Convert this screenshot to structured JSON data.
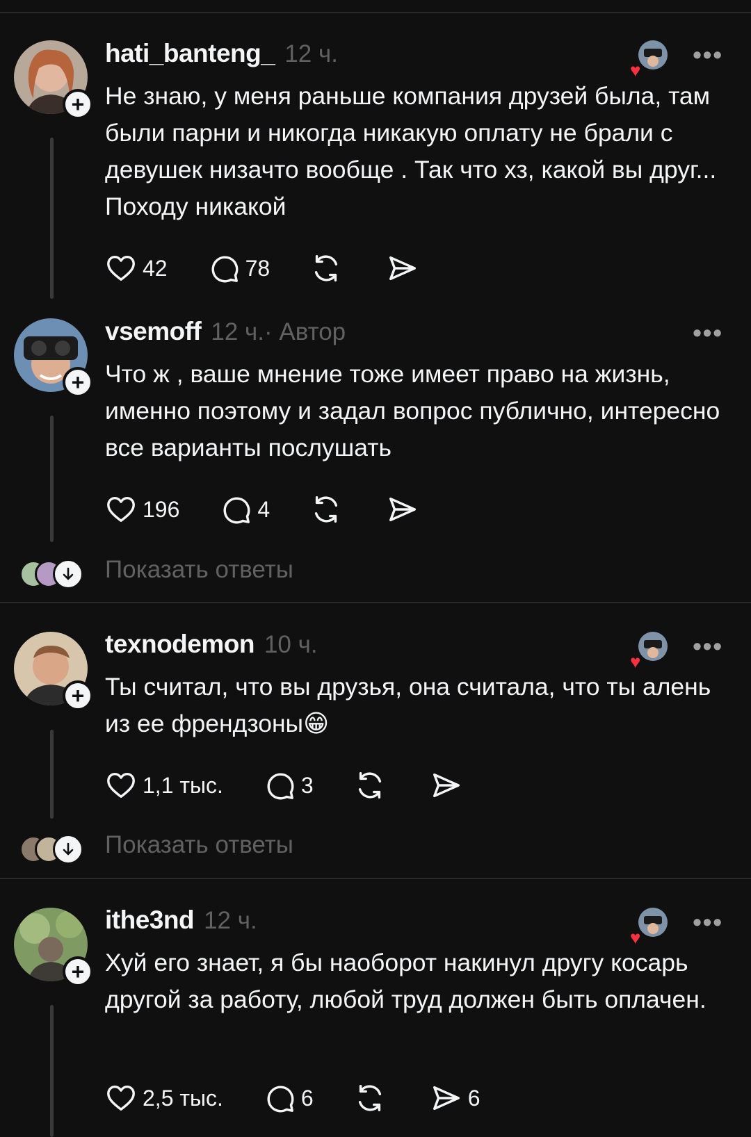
{
  "comments": [
    {
      "username": "hati_banteng_",
      "time": "12 ч.",
      "text": "Не знаю, у меня раньше компания друзей была, там были парни и никогда никакую оплату не брали с девушек низачто вообще . Так что хз, какой вы друг... Походу никакой",
      "likes": "42",
      "replies": "78",
      "avatar_color": "#c98d73"
    },
    {
      "username": "vsemoff",
      "time": "12 ч.",
      "author_label": " · Автор",
      "text": "Что ж , ваше мнение тоже имеет право на жизнь, именно поэтому и задал вопрос публично, интересно все варианты послушать",
      "likes": "196",
      "replies": "4",
      "show_replies": "Показать ответы",
      "avatar_color": "#5c7fa3"
    },
    {
      "username": "texnodemon",
      "time": "10 ч.",
      "text": "Ты считал, что вы друзья, она считала, что ты алень из ее френдзоны😁",
      "likes": "1,1 тыс.",
      "replies": "3",
      "show_replies": "Показать ответы",
      "avatar_color": "#b48a72"
    },
    {
      "username": "ithe3nd",
      "time": "12 ч.",
      "text": "Хуй его знает, я бы наоборот накинул другу косарь другой за работу, любой труд должен быть оплачен.",
      "likes": "2,5 тыс.",
      "replies": "6",
      "shares": "6",
      "avatar_color": "#6f8a5a"
    }
  ],
  "icons": {
    "more": "more-icon",
    "like": "heart-icon",
    "reply": "comment-icon",
    "repost": "repost-icon",
    "share": "send-icon",
    "follow": "plus-icon",
    "expand": "arrow-down-icon"
  },
  "colors": {
    "background": "#101010",
    "text": "#f3f5f7",
    "muted": "#616161",
    "heart": "#ff3040"
  }
}
